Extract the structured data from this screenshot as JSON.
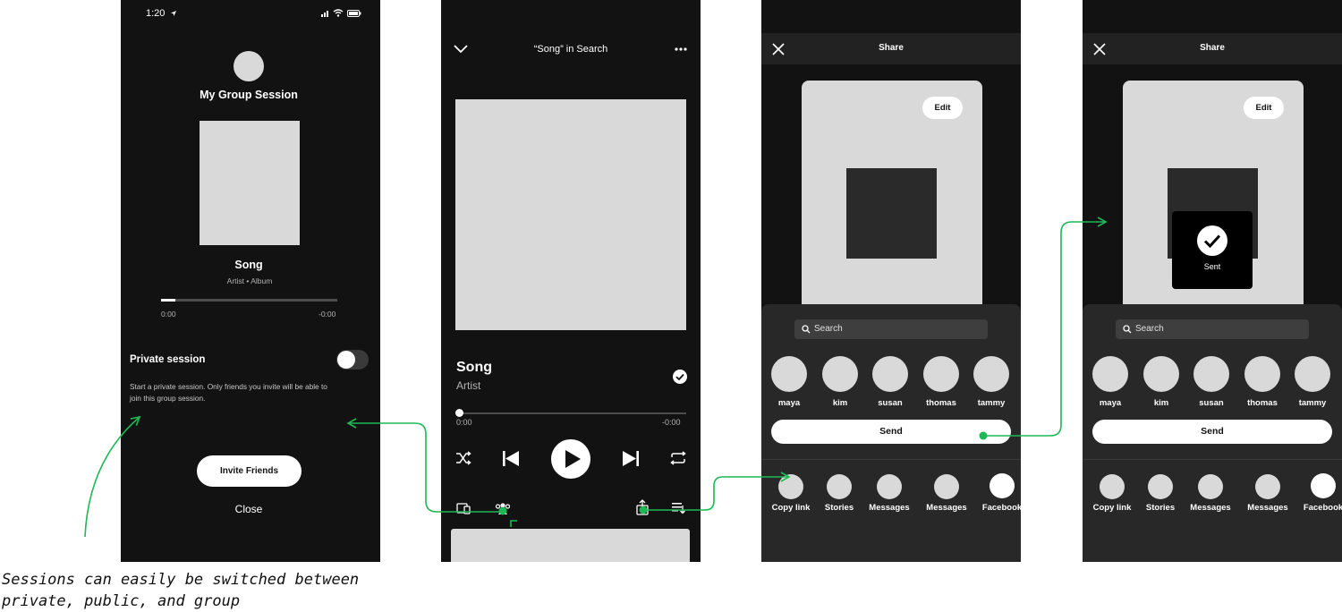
{
  "annotation": {
    "text_line1": "Sessions can easily be switched between",
    "text_line2": "private, public, and group"
  },
  "screen1": {
    "status_time": "1:20",
    "session_title": "My Group Session",
    "song_title": "Song",
    "song_subtitle": "Artist • Album",
    "time_elapsed": "0:00",
    "time_remaining": "-0:00",
    "progress_fraction": 0.08,
    "private_label": "Private session",
    "private_description_line1": "Start a private session. Only friends you invite will be able to",
    "private_description_line2": "join this group session.",
    "private_enabled": false,
    "invite_button": "Invite Friends",
    "close_button": "Close"
  },
  "screen2": {
    "header_title": "“Song” in Search",
    "song_title": "Song",
    "artist": "Artist",
    "time_elapsed": "0:00",
    "time_remaining": "-0:00",
    "progress_fraction": 0.0
  },
  "share": {
    "title": "Share",
    "edit_button": "Edit",
    "search_placeholder": "Search",
    "send_button": "Send",
    "sent_label": "Sent",
    "contacts": [
      "maya",
      "kim",
      "susan",
      "thomas",
      "tammy"
    ],
    "share_targets": [
      "Copy link",
      "Stories",
      "Messages",
      "Messages",
      "Facebook"
    ]
  },
  "colors": {
    "accent_green": "#1DB954",
    "screen_bg": "#121212",
    "sheet_bg": "#282828",
    "placeholder": "#d9d9d9"
  }
}
